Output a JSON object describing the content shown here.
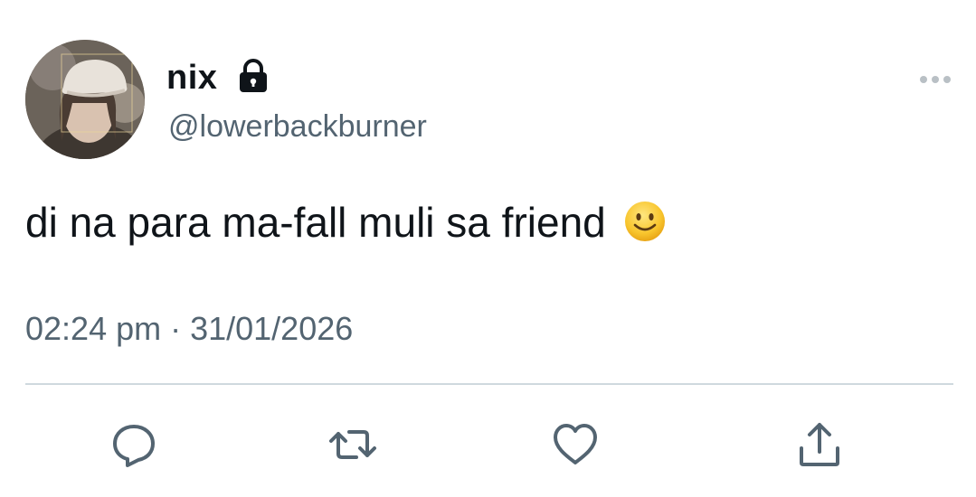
{
  "user": {
    "display_name": "nix",
    "handle": "@lowerbackburner",
    "locked_icon": "lock-icon",
    "avatar": "avatar"
  },
  "tweet": {
    "text": "di na para ma-fall muli sa friend",
    "emoji": "slightly-smiling-face",
    "timestamp": "02:24 pm · 31/01/2026"
  },
  "menu": {
    "icon": "more-horizontal-icon"
  },
  "actions": [
    {
      "name": "reply",
      "icon": "reply-icon"
    },
    {
      "name": "retweet",
      "icon": "retweet-icon"
    },
    {
      "name": "like",
      "icon": "heart-icon"
    },
    {
      "name": "share",
      "icon": "share-icon"
    }
  ],
  "colors": {
    "text_primary": "#0f1419",
    "text_secondary": "#536471",
    "divider": "#cfd9de",
    "icon": "#536471"
  }
}
